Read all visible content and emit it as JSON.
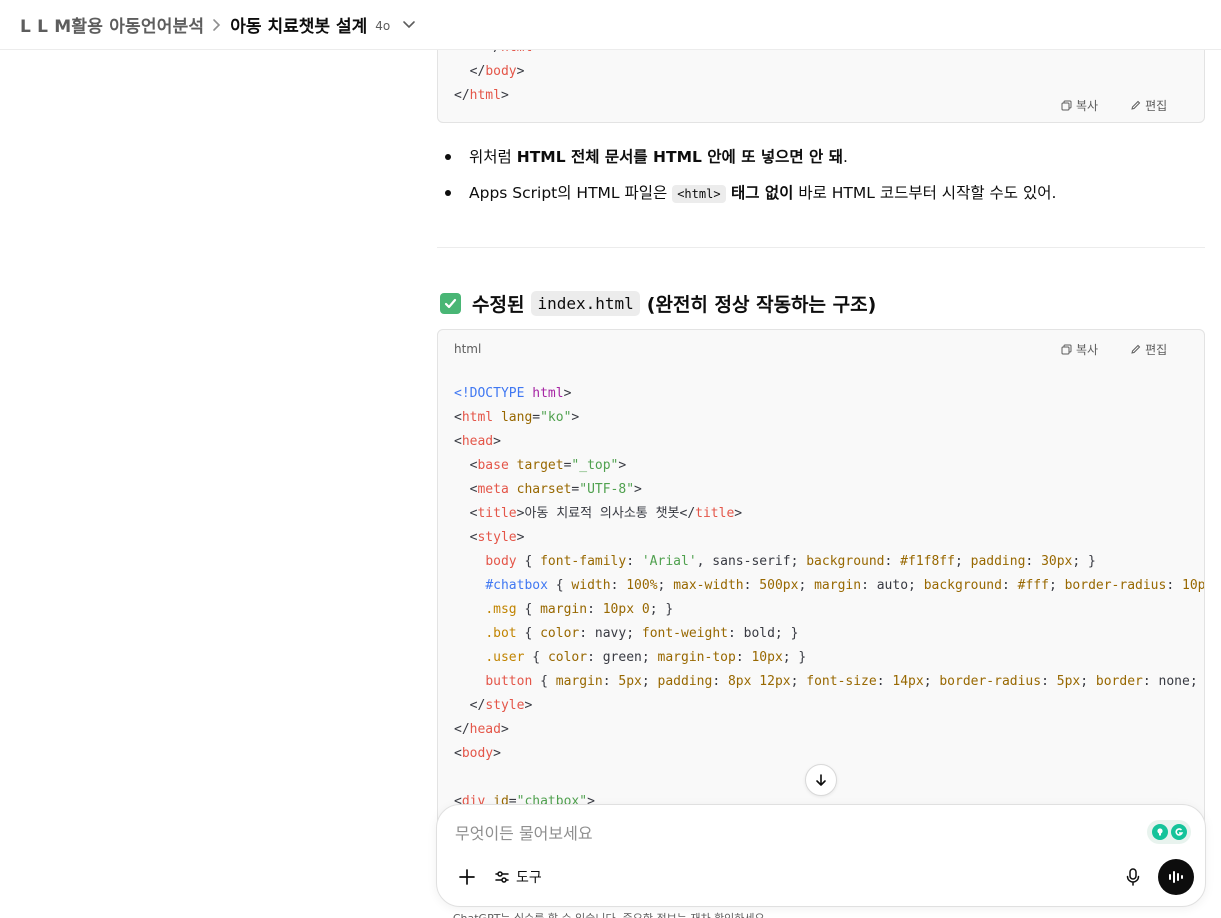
{
  "header": {
    "project": "L L M활용 아동언어분석",
    "chat_title": "아동 치료챗봇 설계",
    "model": "4o"
  },
  "code_block_top": {
    "lines_partial": [
      "    </html>",
      "  </body>",
      "</html>"
    ],
    "copy_label": "복사",
    "edit_label": "편집"
  },
  "bullets": [
    {
      "pre": "위처럼 ",
      "bold": "HTML 전체 문서를 HTML 안에 또 넣으면 안 돼",
      "post": "."
    },
    {
      "pre": "Apps Script의 HTML 파일은 ",
      "code": "<html>",
      "bold": " 태그 없이",
      "post": " 바로 HTML 코드부터 시작할 수도 있어."
    }
  ],
  "section": {
    "title_pre": "수정된",
    "title_code": "index.html",
    "title_post": "(완전히 정상 작동하는 구조)"
  },
  "code_block_main": {
    "language": "html",
    "copy_label": "복사",
    "edit_label": "편집"
  },
  "composer": {
    "placeholder": "무엇이든 물어보세요",
    "tools_label": "도구"
  },
  "disclaimer": "ChatGPT는 실수를 할 수 있습니다. 중요한 정보는 재차 확인하세요.",
  "colors": {
    "accent_check": "#49b675",
    "code_bg": "#f9f9f9",
    "tag": "#e45649",
    "attr": "#986801",
    "string": "#50a14f"
  }
}
